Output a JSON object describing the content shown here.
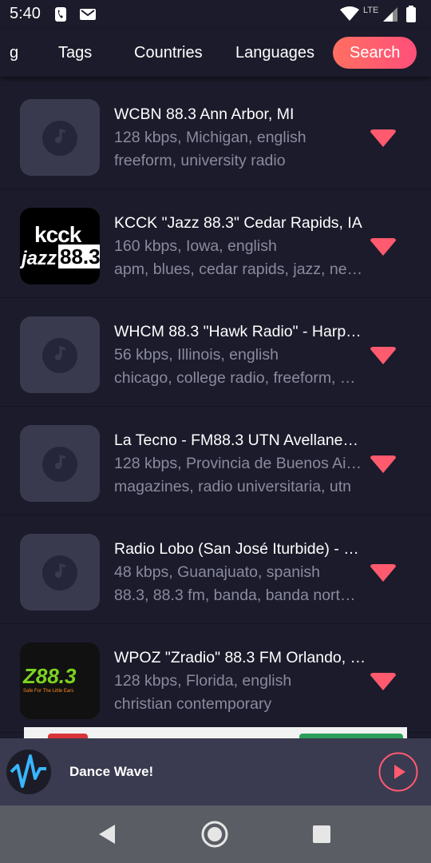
{
  "status_bar": {
    "time": "5:40",
    "network": "LTE"
  },
  "tabs": [
    {
      "label": "g"
    },
    {
      "label": "Tags"
    },
    {
      "label": "Countries"
    },
    {
      "label": "Languages"
    },
    {
      "label": "Search"
    }
  ],
  "active_tab": "Search",
  "stations": [
    {
      "name": "WCBN 88.3 Ann Arbor, MI",
      "info": "128 kbps, Michigan, english",
      "tags": "freeform, university radio",
      "logo": "music-note-placeholder"
    },
    {
      "name": "KCCK \"Jazz 88.3\" Cedar Rapids, IA",
      "info": "160 kbps, Iowa, english",
      "tags": "apm, blues, cedar rapids, jazz, ne…",
      "logo": "kcck-jazz-logo",
      "logo_text_1": "kcck",
      "logo_text_2": "jazz",
      "logo_text_3": "88.3"
    },
    {
      "name": "WHCM 88.3 \"Hawk Radio\" - Harp…",
      "info": "56 kbps, Illinois, english",
      "tags": "chicago, college radio, freeform, …",
      "logo": "music-note-placeholder"
    },
    {
      "name": "La Tecno - FM88.3 UTN Avellane…",
      "info": "128 kbps, Provincia de Buenos Ai…",
      "tags": "magazines, radio universitaria, utn",
      "logo": "music-note-placeholder"
    },
    {
      "name": "Radio Lobo (San José Iturbide) - …",
      "info": "48 kbps, Guanajuato, spanish",
      "tags": "88.3, 88.3 fm, banda, banda nort…",
      "logo": "music-note-placeholder"
    },
    {
      "name": "WPOZ \"Zradio\" 88.3 FM Orlando, …",
      "info": "128 kbps, Florida, english",
      "tags": "christian contemporary",
      "logo": "zradio-logo",
      "logo_text_1": "Z88.3",
      "logo_text_2": "Safe For The Little Ears"
    }
  ],
  "now_playing": {
    "station": "Dance Wave!"
  },
  "colors": {
    "accent": "#ff5a6e",
    "background": "#1b1b2b",
    "player": "#3a3a50",
    "subtext": "#8a8aa0"
  }
}
